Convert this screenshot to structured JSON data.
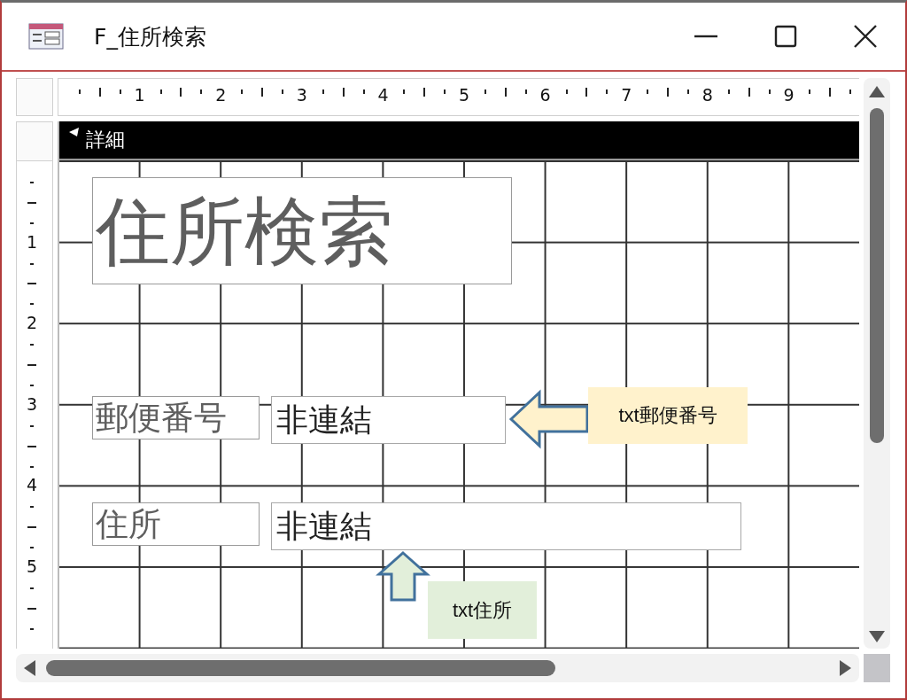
{
  "window": {
    "title": "F_住所検索"
  },
  "ruler": {
    "horizontal_labels": [
      "1",
      "2",
      "3",
      "4",
      "5",
      "6",
      "7",
      "8",
      "9"
    ],
    "vertical_labels": [
      "1",
      "2",
      "3",
      "4",
      "5"
    ]
  },
  "section": {
    "title": "詳細",
    "expanded": true
  },
  "controls": [
    {
      "kind": "title_label",
      "text": "住所検索"
    },
    {
      "kind": "label",
      "text": "郵便番号"
    },
    {
      "kind": "textbox",
      "text": "非連結"
    },
    {
      "kind": "label",
      "text": "住所"
    },
    {
      "kind": "textbox",
      "text": "非連結"
    }
  ],
  "callouts": [
    {
      "text": "txt郵便番号",
      "color": "#fff2cc",
      "kind": "left_arrow"
    },
    {
      "text": "txt住所",
      "color": "#e2efda",
      "kind": "up_arrow"
    }
  ]
}
